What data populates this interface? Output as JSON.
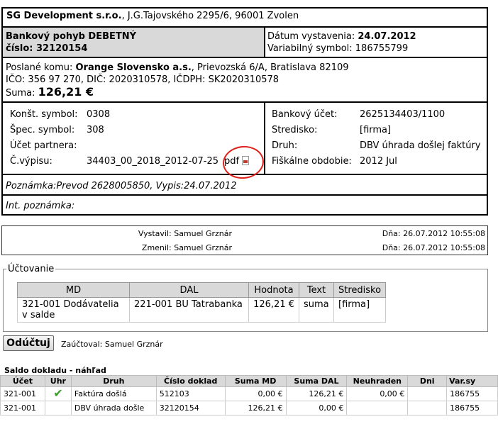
{
  "header": {
    "company": "SG Development s.r.o.",
    "address": ", J.G.Tajovského 2295/6, 96001 Zvolen"
  },
  "doc": {
    "title": "Bankový pohyb DEBETNÝ",
    "number_label": "číslo: ",
    "number": "32120154",
    "date_label": "Dátum vystavenia: ",
    "date": "24.07.2012",
    "varsym_label": "Variabilný symbol: ",
    "varsym": "186755799"
  },
  "recipient": {
    "label": "Poslané komu: ",
    "name": "Orange Slovensko a.s.",
    "address": ", Prievozská 6/A, Bratislava 82109",
    "ids": "IČO: 356 97 270, DIČ: 2020310578, IČDPH: SK2020310578",
    "sum_label": "Suma: ",
    "sum": "126,21 €"
  },
  "details_left": [
    {
      "label": "Konšt. symbol:",
      "value": "0308"
    },
    {
      "label": "Špec. symbol:",
      "value": "308"
    },
    {
      "label": "Účet partnera:",
      "value": ""
    },
    {
      "label": "Č.výpisu:",
      "value": "34403_00_2018_2012-07-25",
      "pdf": "pdf"
    }
  ],
  "details_right": [
    {
      "label": "Bankový účet:",
      "value": "2625134403/1100"
    },
    {
      "label": "Stredisko:",
      "value": "[firma]"
    },
    {
      "label": "Druh:",
      "value": "DBV úhrada došlej faktúry"
    },
    {
      "label": "Fiškálne obdobie:",
      "value": "2012 Jul"
    }
  ],
  "note": "Poznámka:Prevod 2628005850, Vypis:24.07.2012",
  "int_note": "Int. poznámka:",
  "audit": {
    "created_by": "Vystavil: Samuel Grznár",
    "created_on": "Dňa: 26.07.2012 10:55:08",
    "changed_by": "Zmenil: Samuel Grznár",
    "changed_on": "Dňa: 26.07.2012 10:55:08"
  },
  "posting": {
    "legend": "Účtovanie",
    "headers": [
      "MD",
      "DAL",
      "Hodnota",
      "Text",
      "Stredisko"
    ],
    "row": {
      "md_line1": "321-001 Dodávatelia",
      "md_line2": "v salde",
      "dal": "221-001 BU Tatrabanka",
      "value": "126,21 €",
      "text": "suma",
      "center": "[firma]"
    }
  },
  "unpost": {
    "button": "Odúčtuj",
    "posted_by": "Zaúčtoval: Samuel Grznár"
  },
  "balance": {
    "title": "Saldo dokladu - náhľad",
    "headers": [
      "Účet",
      "Uhr",
      "Druh",
      "Číslo doklad",
      "Suma MD",
      "Suma DAL",
      "Neuhraden",
      "Dni",
      "Var.sy"
    ],
    "rows": [
      {
        "account": "321-001",
        "paid": "✔",
        "type": "Faktúra došlá",
        "doc": "512103",
        "md": "0,00 €",
        "dal": "126,21 €",
        "unpaid": "0,00 €",
        "days": "",
        "vs": "186755"
      },
      {
        "account": "321-001",
        "paid": "",
        "type": "DBV úhrada došle",
        "doc": "32120154",
        "md": "126,21 €",
        "dal": "0,00 €",
        "unpaid": "",
        "days": "",
        "vs": "186755"
      }
    ]
  },
  "colors": {
    "header_grey": "#d9d9d9",
    "annotation_red": "#e0201a",
    "check_green": "#3a9a2a"
  }
}
